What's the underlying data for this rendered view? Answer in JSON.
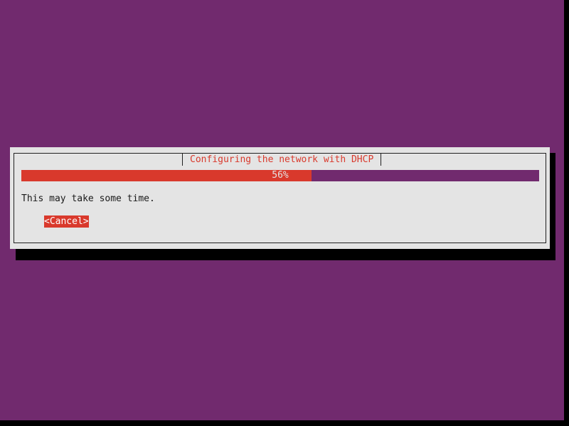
{
  "dialog": {
    "title": "Configuring the network with DHCP",
    "progress": {
      "percent": 56,
      "label": "56%"
    },
    "message": "This may take some time.",
    "cancel_label": "<Cancel>"
  },
  "colors": {
    "background": "#712a6e",
    "dialog": "#e4e4e4",
    "accent": "#d9392c",
    "shadow": "#000000"
  }
}
